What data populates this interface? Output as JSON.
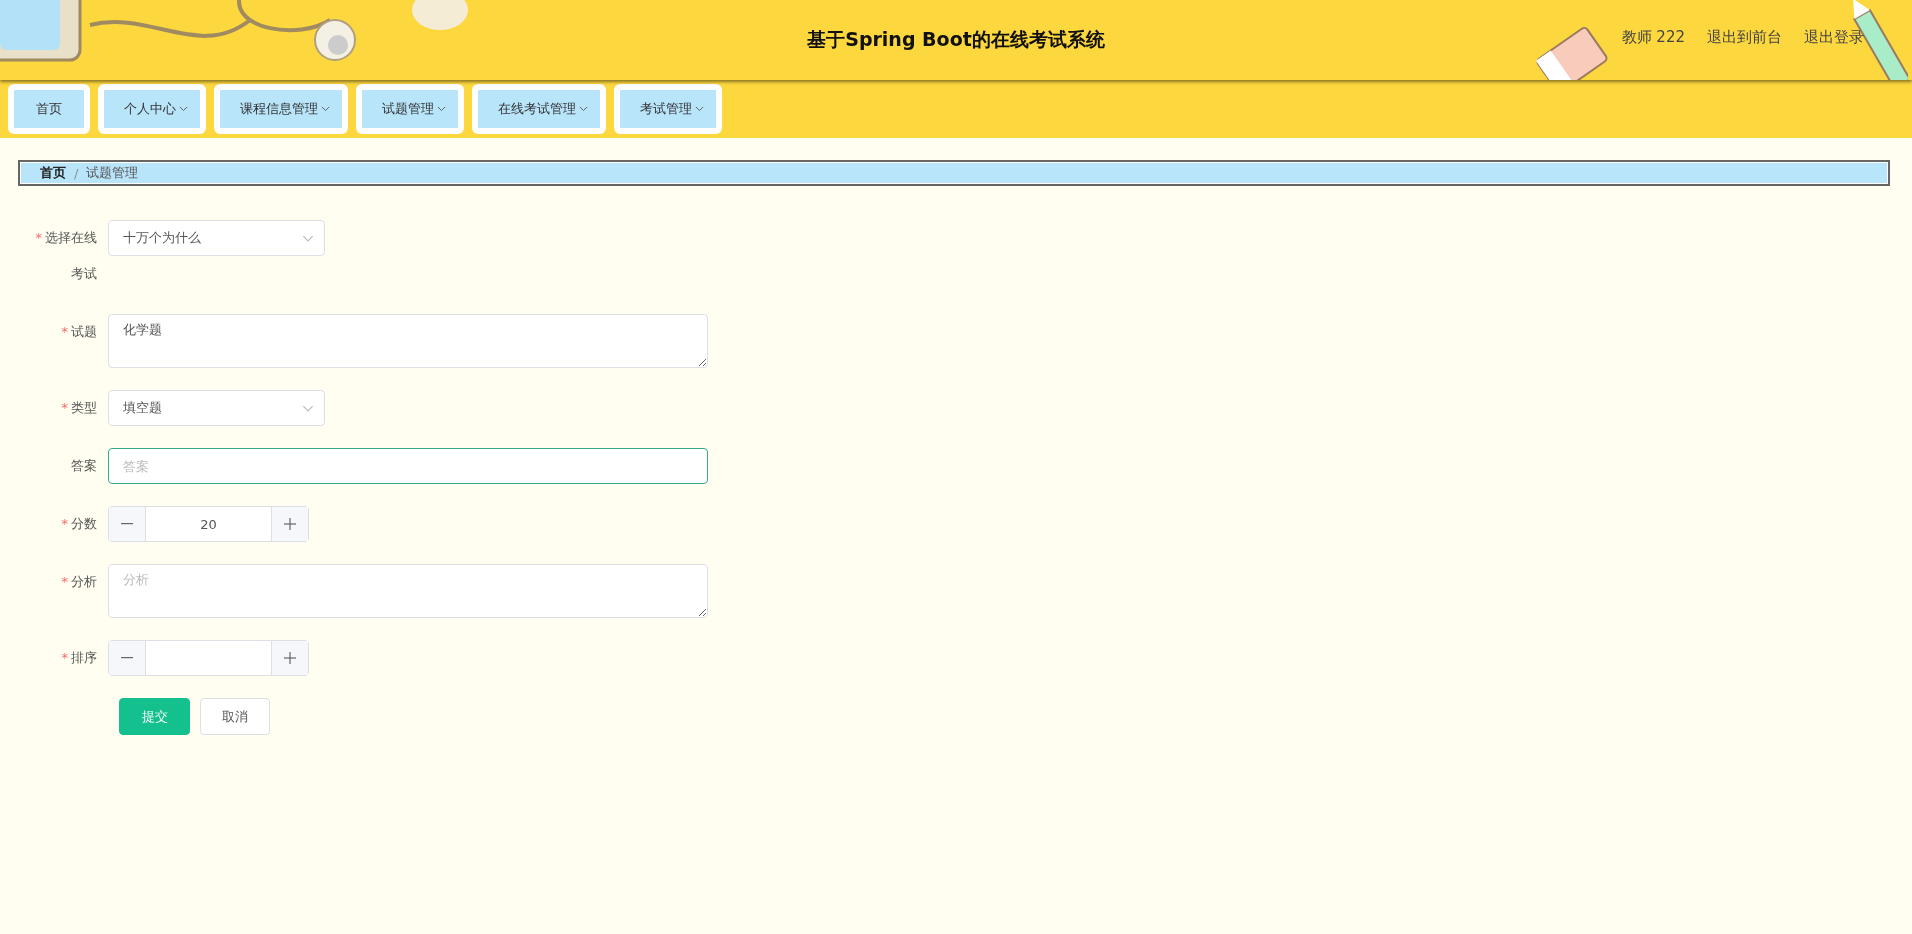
{
  "header": {
    "title": "基于Spring Boot的在线考试系统",
    "links": [
      {
        "label": "教师 222"
      },
      {
        "label": "退出到前台"
      },
      {
        "label": "退出登录"
      }
    ]
  },
  "nav": [
    {
      "label": "首页",
      "dropdown": false
    },
    {
      "label": "个人中心",
      "dropdown": true
    },
    {
      "label": "课程信息管理",
      "dropdown": true
    },
    {
      "label": "试题管理",
      "dropdown": true
    },
    {
      "label": "在线考试管理",
      "dropdown": true
    },
    {
      "label": "考试管理",
      "dropdown": true
    }
  ],
  "breadcrumb_separator": "/",
  "breadcrumb": [
    {
      "label": "首页",
      "current": false
    },
    {
      "label": "试题管理",
      "current": true
    }
  ],
  "form": {
    "required_mark": "*",
    "fields": [
      {
        "kind": "select",
        "label": "选择在线考试",
        "required": true,
        "value": "十万个为什么"
      },
      {
        "kind": "textarea",
        "label": "试题",
        "required": true,
        "value": "化学题"
      },
      {
        "kind": "select",
        "label": "类型",
        "required": true,
        "value": "填空题"
      },
      {
        "kind": "input",
        "label": "答案",
        "required": false,
        "placeholder": "答案",
        "focused": true
      },
      {
        "kind": "number",
        "label": "分数",
        "required": true,
        "value": "20"
      },
      {
        "kind": "textarea",
        "label": "分析",
        "required": true,
        "placeholder": "分析"
      },
      {
        "kind": "number",
        "label": "排序",
        "required": true
      }
    ],
    "buttons": [
      {
        "label": "提交",
        "primary": true
      },
      {
        "label": "取消",
        "primary": false
      }
    ]
  }
}
